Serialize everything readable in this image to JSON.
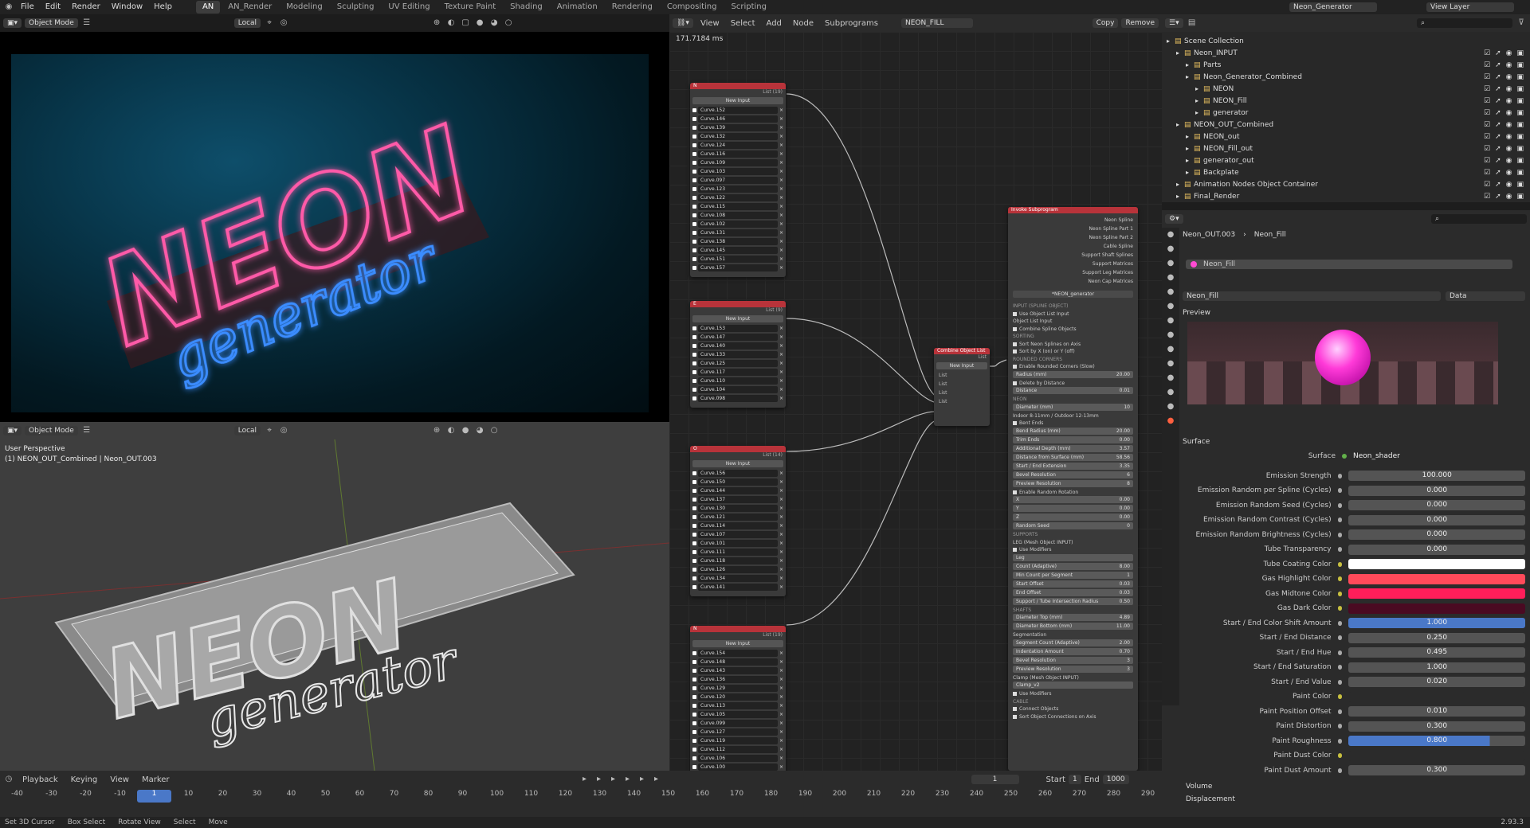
{
  "topbar": {
    "menus": [
      "File",
      "Edit",
      "Render",
      "Window",
      "Help"
    ],
    "workspaces": [
      "AN",
      "AN_Render",
      "Modeling",
      "Sculpting",
      "UV Editing",
      "Texture Paint",
      "Shading",
      "Animation",
      "Rendering",
      "Compositing",
      "Scripting"
    ],
    "scene": "Neon_Generator",
    "view_layer": "View Layer"
  },
  "viewport_top": {
    "mode": "Object Mode",
    "orientation": "Local",
    "render_title": "NEON",
    "render_subtitle": "generator"
  },
  "viewport_bottom": {
    "mode": "Object Mode",
    "orientation": "Local",
    "perspective": "User Perspective",
    "object_info": "(1) NEON_OUT_Combined | Neon_OUT.003",
    "title": "NEON",
    "subtitle": "generator"
  },
  "node_editor": {
    "menus": [
      "View",
      "Select",
      "Add",
      "Node",
      "Subprograms"
    ],
    "tree_name": "NEON_FILL",
    "copy_label": "Copy",
    "remove_label": "Remove",
    "time": "171.7184 ms",
    "lists": [
      {
        "title": "N",
        "sub": "List (19)",
        "new_input": "New Input",
        "items": [
          "Curve.152",
          "Curve.146",
          "Curve.139",
          "Curve.132",
          "Curve.124",
          "Curve.116",
          "Curve.109",
          "Curve.103",
          "Curve.097",
          "Curve.123",
          "Curve.122",
          "Curve.115",
          "Curve.108",
          "Curve.102",
          "Curve.131",
          "Curve.138",
          "Curve.145",
          "Curve.151",
          "Curve.157"
        ]
      },
      {
        "title": "E",
        "sub": "List (9)",
        "new_input": "New Input",
        "items": [
          "Curve.153",
          "Curve.147",
          "Curve.140",
          "Curve.133",
          "Curve.125",
          "Curve.117",
          "Curve.110",
          "Curve.104",
          "Curve.098"
        ]
      },
      {
        "title": "O",
        "sub": "List (14)",
        "new_input": "New Input",
        "items": [
          "Curve.156",
          "Curve.150",
          "Curve.144",
          "Curve.137",
          "Curve.130",
          "Curve.121",
          "Curve.114",
          "Curve.107",
          "Curve.101",
          "Curve.111",
          "Curve.118",
          "Curve.126",
          "Curve.134",
          "Curve.141"
        ]
      },
      {
        "title": "N",
        "sub": "List (19)",
        "new_input": "New Input",
        "items": [
          "Curve.154",
          "Curve.148",
          "Curve.143",
          "Curve.136",
          "Curve.129",
          "Curve.120",
          "Curve.113",
          "Curve.105",
          "Curve.099",
          "Curve.127",
          "Curve.119",
          "Curve.112",
          "Curve.106",
          "Curve.100",
          "Curve.128",
          "Curve.135"
        ]
      }
    ],
    "combine": {
      "title": "Combine Object List",
      "sub": "List",
      "new_input": "New Input",
      "sockets": [
        "List",
        "List",
        "List",
        "List"
      ]
    },
    "invoke": {
      "title": "Invoke Subprogram",
      "outputs": [
        "Neon Spline",
        "Neon Spline Part 1",
        "Neon Spline Part 2",
        "Cable Spline",
        "Support Shaft Splines",
        "Support Matrices",
        "Support Leg Matrices",
        "Neon Cap Matrices"
      ],
      "subprogram": "*NEON_generator",
      "rows": [
        {
          "t": "h",
          "l": "INPUT (SPLINE OBJECT)"
        },
        {
          "t": "c",
          "l": "Use Object List Input"
        },
        {
          "t": "r",
          "l": "Object List Input"
        },
        {
          "t": "c",
          "l": "Combine Spline Objects"
        },
        {
          "t": "h",
          "l": "SORTING"
        },
        {
          "t": "c",
          "l": "Sort Neon Splines on Axis"
        },
        {
          "t": "c",
          "l": "Sort by X (on) or Y (off)"
        },
        {
          "t": "h",
          "l": "ROUNDED CORNERS"
        },
        {
          "t": "c",
          "l": "Enable Rounded Corners (Slow)"
        },
        {
          "t": "f",
          "l": "Radius (mm)",
          "v": "20.00"
        },
        {
          "t": "c",
          "l": "Delete by Distance"
        },
        {
          "t": "f",
          "l": "Distance",
          "v": "0.01"
        },
        {
          "t": "h",
          "l": "NEON"
        },
        {
          "t": "f",
          "l": "Diameter (mm)",
          "v": "10"
        },
        {
          "t": "r",
          "l": "Indoor 8-11mm / Outdoor 12-13mm"
        },
        {
          "t": "c",
          "l": "Bent Ends"
        },
        {
          "t": "f",
          "l": "Bend Radius (mm)",
          "v": "20.00"
        },
        {
          "t": "f",
          "l": "Trim Ends",
          "v": "0.00"
        },
        {
          "t": "f",
          "l": "Additional Depth (mm)",
          "v": "3.57"
        },
        {
          "t": "f",
          "l": "Distance from Surface (mm)",
          "v": "58.56"
        },
        {
          "t": "f",
          "l": "Start / End Extension",
          "v": "3.35"
        },
        {
          "t": "f",
          "l": "Bevel Resolution",
          "v": "6"
        },
        {
          "t": "f",
          "l": "Preview Resolution",
          "v": "8"
        },
        {
          "t": "c",
          "l": "Enable Random Rotation"
        },
        {
          "t": "f",
          "l": "X",
          "v": "0.00"
        },
        {
          "t": "f",
          "l": "Y",
          "v": "0.00"
        },
        {
          "t": "f",
          "l": "Z",
          "v": "0.00"
        },
        {
          "t": "f",
          "l": "Random Seed",
          "v": "0"
        },
        {
          "t": "h",
          "l": "SUPPORTS"
        },
        {
          "t": "r",
          "l": "LEG (Mesh Object INPUT)"
        },
        {
          "t": "c",
          "l": "Use Modifiers"
        },
        {
          "t": "f",
          "l": "Leg",
          "v": ""
        },
        {
          "t": "f",
          "l": "Count (Adaptive)",
          "v": "8.00"
        },
        {
          "t": "f",
          "l": "Min Count per Segment",
          "v": "1"
        },
        {
          "t": "f",
          "l": "Start Offset",
          "v": "0.03"
        },
        {
          "t": "f",
          "l": "End Offset",
          "v": "0.03"
        },
        {
          "t": "f",
          "l": "Support / Tube Intersection Radius",
          "v": "0.50"
        },
        {
          "t": "h",
          "l": "SHAFTS"
        },
        {
          "t": "f",
          "l": "Diameter Top (mm)",
          "v": "4.89"
        },
        {
          "t": "f",
          "l": "Diameter Bottom (mm)",
          "v": "11.00"
        },
        {
          "t": "r",
          "l": "Segmentation"
        },
        {
          "t": "f",
          "l": "Segment Count (Adaptive)",
          "v": "2.00"
        },
        {
          "t": "f",
          "l": "Indentation Amount",
          "v": "0.70"
        },
        {
          "t": "f",
          "l": "Bevel Resolution",
          "v": "3"
        },
        {
          "t": "f",
          "l": "Preview Resolution",
          "v": "3"
        },
        {
          "t": "r",
          "l": "Clamp (Mesh Object INPUT)"
        },
        {
          "t": "f",
          "l": "Clamp_v2",
          "v": ""
        },
        {
          "t": "c",
          "l": "Use Modifiers"
        },
        {
          "t": "h",
          "l": "CABLE"
        },
        {
          "t": "c",
          "l": "Connect Objects"
        },
        {
          "t": "c",
          "l": "Sort Object Connections on Axis"
        }
      ]
    }
  },
  "outliner": {
    "items": [
      {
        "label": "Scene Collection",
        "indent": 0
      },
      {
        "label": "Neon_INPUT",
        "indent": 1
      },
      {
        "label": "Parts",
        "indent": 2
      },
      {
        "label": "Neon_Generator_Combined",
        "indent": 2
      },
      {
        "label": "NEON",
        "indent": 3
      },
      {
        "label": "NEON_Fill",
        "indent": 3
      },
      {
        "label": "generator",
        "indent": 3
      },
      {
        "label": "NEON_OUT_Combined",
        "indent": 1
      },
      {
        "label": "NEON_out",
        "indent": 2
      },
      {
        "label": "NEON_Fill_out",
        "indent": 2
      },
      {
        "label": "generator_out",
        "indent": 2
      },
      {
        "label": "Backplate",
        "indent": 2
      },
      {
        "label": "Animation Nodes Object Container",
        "indent": 1
      },
      {
        "label": "Final_Render",
        "indent": 1
      }
    ]
  },
  "properties": {
    "object": "Neon_OUT.003",
    "material": "Neon_Fill",
    "slot": "Neon_Fill",
    "material_field": "Neon_Fill",
    "link": "Data",
    "preview_label": "Preview",
    "surface_section": "Surface",
    "surface_label": "Surface",
    "surface_value": "Neon_shader",
    "rows": [
      {
        "label": "Emission Strength",
        "value": "100.000",
        "color": null
      },
      {
        "label": "Emission Random per Spline (Cycles)",
        "value": "0.000",
        "color": null
      },
      {
        "label": "Emission Random Seed (Cycles)",
        "value": "0.000",
        "color": null
      },
      {
        "label": "Emission Random Contrast (Cycles)",
        "value": "0.000",
        "color": null
      },
      {
        "label": "Emission Random Brightness (Cycles)",
        "value": "0.000",
        "color": null
      },
      {
        "label": "Tube Transparency",
        "value": "0.000",
        "color": null
      },
      {
        "label": "Tube Coating Color",
        "value": "",
        "color": "#ffffff"
      },
      {
        "label": "Gas Highlight Color",
        "value": "",
        "color": "#ff4a5a"
      },
      {
        "label": "Gas Midtone Color",
        "value": "",
        "color": "#ff1e5a"
      },
      {
        "label": "Gas Dark Color",
        "value": "",
        "color": "#4a0a22"
      },
      {
        "label": "Start / End Color Shift Amount",
        "value": "1.000",
        "color": "#4a78c8"
      },
      {
        "label": "Start / End Distance",
        "value": "0.250",
        "color": null
      },
      {
        "label": "Start / End Hue",
        "value": "0.495",
        "color": null
      },
      {
        "label": "Start / End Saturation",
        "value": "1.000",
        "color": null
      },
      {
        "label": "Start / End Value",
        "value": "0.020",
        "color": null
      },
      {
        "label": "Paint Color",
        "value": "",
        "color": "#2b2b2b"
      },
      {
        "label": "Paint Position Offset",
        "value": "0.010",
        "color": null
      },
      {
        "label": "Paint Distortion",
        "value": "0.300",
        "color": null
      },
      {
        "label": "Paint Roughness",
        "value": "0.800",
        "color": "#4a78c8"
      },
      {
        "label": "Paint Dust Color",
        "value": "",
        "color": "#2b2b2b"
      },
      {
        "label": "Paint Dust Amount",
        "value": "0.300",
        "color": null
      }
    ],
    "volume": "Volume",
    "displacement": "Displacement"
  },
  "timeline": {
    "menus": [
      "Playback",
      "Keying",
      "View",
      "Marker"
    ],
    "current": "1",
    "start_label": "Start",
    "start": "1",
    "end_label": "End",
    "end": "1000",
    "ticks": [
      "-40",
      "-30",
      "-20",
      "-10",
      "1",
      "10",
      "20",
      "30",
      "40",
      "50",
      "60",
      "70",
      "80",
      "90",
      "100",
      "110",
      "120",
      "130",
      "140",
      "150",
      "160",
      "170",
      "180",
      "190",
      "200",
      "210",
      "220",
      "230",
      "240",
      "250",
      "260",
      "270",
      "280",
      "290"
    ]
  },
  "status": {
    "items": [
      "Set 3D Cursor",
      "Box Select",
      "Rotate View",
      "Select",
      "Move"
    ],
    "version": "2.93.3"
  },
  "accent_colors": {
    "node_header": "#b8333a",
    "active_blue": "#4a78c8",
    "neon_pink": "#ff3aa8",
    "neon_blue": "#2a6cff"
  }
}
